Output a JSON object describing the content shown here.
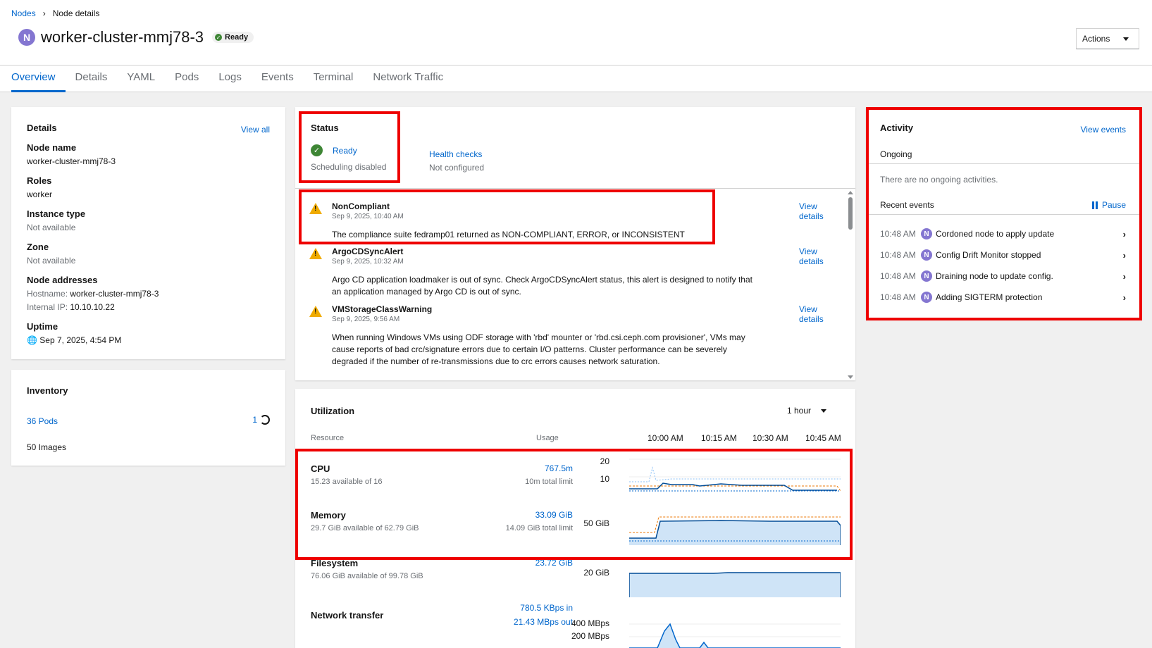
{
  "breadcrumb": {
    "parent": "Nodes",
    "current": "Node details"
  },
  "node": {
    "badge": "N",
    "name": "worker-cluster-mmj78-3",
    "status": "Ready"
  },
  "actions_label": "Actions",
  "tabs": [
    "Overview",
    "Details",
    "YAML",
    "Pods",
    "Logs",
    "Events",
    "Terminal",
    "Network Traffic"
  ],
  "details": {
    "title": "Details",
    "view_all": "View all",
    "fields": {
      "node_name_label": "Node name",
      "node_name": "worker-cluster-mmj78-3",
      "roles_label": "Roles",
      "roles": "worker",
      "instance_type_label": "Instance type",
      "instance_type": "Not available",
      "zone_label": "Zone",
      "zone": "Not available",
      "addresses_label": "Node addresses",
      "hostname_key": "Hostname:",
      "hostname": "worker-cluster-mmj78-3",
      "internal_ip_key": "Internal IP:",
      "internal_ip": "10.10.10.22",
      "uptime_label": "Uptime",
      "uptime": "Sep 7, 2025, 4:54 PM"
    }
  },
  "inventory": {
    "title": "Inventory",
    "pods": "36 Pods",
    "pods_pending": "1",
    "images": "50 Images"
  },
  "status": {
    "title": "Status",
    "ready": "Ready",
    "scheduling": "Scheduling disabled",
    "health_checks": "Health checks",
    "health_status": "Not configured",
    "alerts": [
      {
        "name": "NonCompliant",
        "time": "Sep 9, 2025, 10:40 AM",
        "desc": "The compliance suite fedramp01 returned as NON-COMPLIANT, ERROR, or INCONSISTENT",
        "link": "View details"
      },
      {
        "name": "ArgoCDSyncAlert",
        "time": "Sep 9, 2025, 10:32 AM",
        "desc": "Argo CD application loadmaker is out of sync. Check ArgoCDSyncAlert status, this alert is designed to notify that an application managed by Argo CD is out of sync.",
        "link": "View details"
      },
      {
        "name": "VMStorageClassWarning",
        "time": "Sep 9, 2025, 9:56 AM",
        "desc": "When running Windows VMs using ODF storage with 'rbd' mounter or 'rbd.csi.ceph.com provisioner', VMs may cause reports of bad crc/signature errors due to certain I/O patterns. Cluster performance can be severely degraded if the number of re-transmissions due to crc errors causes network saturation.",
        "link": "View details"
      }
    ]
  },
  "utilization": {
    "title": "Utilization",
    "range": "1 hour",
    "col_resource": "Resource",
    "col_usage": "Usage",
    "times": [
      "10:00 AM",
      "10:15 AM",
      "10:30 AM",
      "10:45 AM"
    ],
    "cpu": {
      "name": "CPU",
      "sub": "15.23 available of 16",
      "usage": "767.5m",
      "limit": "10m total limit",
      "axis": [
        "20",
        "10"
      ]
    },
    "memory": {
      "name": "Memory",
      "sub": "29.7 GiB available of 62.79 GiB",
      "usage": "33.09 GiB",
      "limit": "14.09 GiB total limit",
      "axis": [
        "50 GiB"
      ]
    },
    "filesystem": {
      "name": "Filesystem",
      "sub": "76.06 GiB available of 99.78 GiB",
      "usage": "23.72 GiB",
      "axis": [
        "20 GiB"
      ]
    },
    "network": {
      "name": "Network transfer",
      "in": "780.5 KBps in",
      "out": "21.43 MBps out",
      "axis": [
        "400 MBps",
        "200 MBps"
      ]
    }
  },
  "activity": {
    "title": "Activity",
    "view_events": "View events",
    "ongoing": "Ongoing",
    "no_ongoing": "There are no ongoing activities.",
    "recent": "Recent events",
    "pause": "Pause",
    "events": [
      {
        "time": "10:48 AM",
        "text": "Cordoned node to apply update"
      },
      {
        "time": "10:48 AM",
        "text": "Config Drift Monitor stopped"
      },
      {
        "time": "10:48 AM",
        "text": "Draining node to update config."
      },
      {
        "time": "10:48 AM",
        "text": "Adding SIGTERM protection"
      }
    ]
  },
  "colors": {
    "link": "#0066cc",
    "ready": "#3e8635",
    "warning": "#f0ab00",
    "node_badge": "#8476d1",
    "highlight": "#ee0000",
    "chart_line": "#06c",
    "limit_line": "#ec7a08"
  }
}
